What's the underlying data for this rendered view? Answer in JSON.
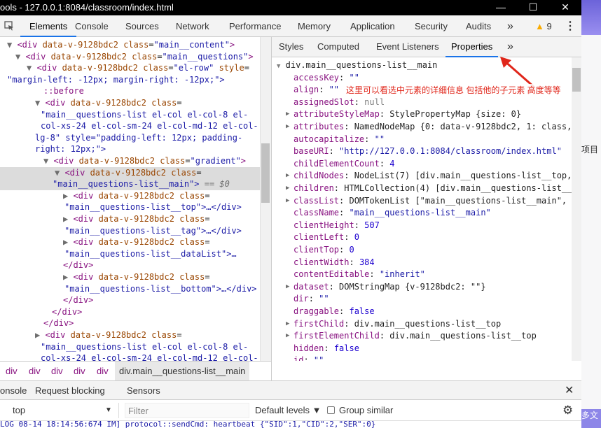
{
  "window": {
    "title": "ools - 127.0.0.1:8084/classroom/index.html",
    "minimize": "—",
    "maximize": "☐",
    "close": "✕"
  },
  "toolbar": {
    "inspect_icon": "inspect-icon",
    "tabs": [
      "Elements",
      "Console",
      "Sources",
      "Network",
      "Performance",
      "Memory",
      "Application",
      "Security",
      "Audits"
    ],
    "more": "»",
    "warnings": "9",
    "menu": "⋮"
  },
  "dom": [
    {
      "arrow": "▼",
      "tag": "<div ",
      "attrs": [
        [
          "data-v-9128bdc2",
          ""
        ],
        [
          "class",
          "\"main__content\""
        ]
      ],
      "end": ">"
    },
    {
      "arrow": "▼",
      "tag": "<div ",
      "attrs": [
        [
          "data-v-9128bdc2",
          ""
        ],
        [
          "class",
          "\"main__questions\""
        ]
      ],
      "end": ">"
    },
    {
      "arrow": "▼",
      "tag": "<div ",
      "attrs": [
        [
          "data-v-9128bdc2",
          ""
        ],
        [
          "class",
          "\"el-row\""
        ],
        [
          "style",
          ""
        ]
      ],
      "end": ""
    },
    {
      "cont": "\"margin-left: -12px; margin-right: -12px;\">"
    },
    {
      "pseudo": "::before"
    },
    {
      "arrow": "▼",
      "tag": "<div ",
      "attrs": [
        [
          "data-v-9128bdc2",
          ""
        ],
        [
          "class",
          ""
        ]
      ],
      "end": ""
    },
    {
      "cont": "\"main__questions-list el-col el-col-8 el-"
    },
    {
      "cont": "col-xs-24 el-col-sm-24 el-col-md-12 el-col-"
    },
    {
      "cont": "lg-8\" style=\"padding-left: 12px; padding-"
    },
    {
      "cont": "right: 12px;\">"
    },
    {
      "arrow": "▼",
      "tag": "<div ",
      "attrs": [
        [
          "data-v-9128bdc2",
          ""
        ],
        [
          "class",
          "\"gradient\""
        ]
      ],
      "end": ">"
    },
    {
      "arrow": "▼",
      "tag": "<div ",
      "attrs": [
        [
          "data-v-9128bdc2",
          ""
        ],
        [
          "class",
          ""
        ]
      ],
      "end": ""
    },
    {
      "cont": "\"main__questions-list__main\">",
      "extra": " == $0"
    },
    {
      "arrow": "▶",
      "tag": "<div ",
      "attrs": [
        [
          "data-v-9128bdc2",
          ""
        ],
        [
          "class",
          ""
        ]
      ],
      "end": ""
    },
    {
      "cont": "\"main__questions-list__top\">…</div>"
    },
    {
      "arrow": "▶",
      "tag": "<div ",
      "attrs": [
        [
          "data-v-9128bdc2",
          ""
        ],
        [
          "class",
          ""
        ]
      ],
      "end": ""
    },
    {
      "cont": "\"main__questions-list__tag\">…</div>"
    },
    {
      "arrow": "▶",
      "tag": "<div ",
      "attrs": [
        [
          "data-v-9128bdc2",
          ""
        ],
        [
          "class",
          ""
        ]
      ],
      "end": ""
    },
    {
      "cont": "\"main__questions-list__dataList\">…"
    },
    {
      "close": "</div>"
    },
    {
      "arrow": "▶",
      "tag": "<div ",
      "attrs": [
        [
          "data-v-9128bdc2",
          ""
        ],
        [
          "class",
          ""
        ]
      ],
      "end": ""
    },
    {
      "cont": "\"main__questions-list__bottom\">…</div>"
    },
    {
      "close": "</div>"
    },
    {
      "close": "</div>"
    },
    {
      "close": "</div>"
    },
    {
      "arrow": "▶",
      "tag": "<div ",
      "attrs": [
        [
          "data-v-9128bdc2",
          ""
        ],
        [
          "class",
          ""
        ]
      ],
      "end": ""
    },
    {
      "cont": "\"main__questions-list el-col el-col-8 el-"
    },
    {
      "cont": "col-xs-24 el-col-sm-24 el-col-md-12 el-col-"
    }
  ],
  "breadcrumbs": [
    "div",
    "div",
    "div",
    "div",
    "div",
    "div.main__questions-list__main"
  ],
  "side_tabs": [
    "Styles",
    "Computed",
    "Event Listeners",
    "Properties",
    "»"
  ],
  "properties": {
    "header": "div.main__questions-list__main",
    "rows": [
      {
        "key": "accessKey",
        "val": "\"\"",
        "kind": "str"
      },
      {
        "key": "align",
        "val": "\"\"",
        "kind": "str"
      },
      {
        "key": "assignedSlot",
        "val": "null",
        "kind": "gray"
      },
      {
        "key": "attributeStyleMap",
        "val": "StylePropertyMap {size: 0}",
        "kind": "obj",
        "arrow": true
      },
      {
        "key": "attributes",
        "val": "NamedNodeMap {0: data-v-9128bdc2, 1: class,",
        "kind": "obj",
        "arrow": true
      },
      {
        "key": "autocapitalize",
        "val": "\"\"",
        "kind": "str"
      },
      {
        "key": "baseURI",
        "val": "\"http://127.0.0.1:8084/classroom/index.html\"",
        "kind": "str"
      },
      {
        "key": "childElementCount",
        "val": "4",
        "kind": "num"
      },
      {
        "key": "childNodes",
        "val": "NodeList(7) [div.main__questions-list__top,",
        "kind": "obj",
        "arrow": true
      },
      {
        "key": "children",
        "val": "HTMLCollection(4) [div.main__questions-list__",
        "kind": "obj",
        "arrow": true
      },
      {
        "key": "classList",
        "val": "DOMTokenList [\"main__questions-list__main\",",
        "kind": "obj",
        "arrow": true
      },
      {
        "key": "className",
        "val": "\"main__questions-list__main\"",
        "kind": "str"
      },
      {
        "key": "clientHeight",
        "val": "507",
        "kind": "num"
      },
      {
        "key": "clientLeft",
        "val": "0",
        "kind": "num"
      },
      {
        "key": "clientTop",
        "val": "0",
        "kind": "num"
      },
      {
        "key": "clientWidth",
        "val": "384",
        "kind": "num"
      },
      {
        "key": "contentEditable",
        "val": "\"inherit\"",
        "kind": "str"
      },
      {
        "key": "dataset",
        "val": "DOMStringMap {v-9128bdc2: \"\"}",
        "kind": "obj",
        "arrow": true
      },
      {
        "key": "dir",
        "val": "\"\"",
        "kind": "str"
      },
      {
        "key": "draggable",
        "val": "false",
        "kind": "num"
      },
      {
        "key": "firstChild",
        "val": "div.main__questions-list__top",
        "kind": "obj",
        "arrow": true
      },
      {
        "key": "firstElementChild",
        "val": "div.main__questions-list__top",
        "kind": "obj",
        "arrow": true
      },
      {
        "key": "hidden",
        "val": "false",
        "kind": "num"
      },
      {
        "key": "id",
        "val": "\"\"",
        "kind": "str"
      }
    ]
  },
  "annotation": "这里可以看选中元素的详细信息 包括他的子元素 高度等等",
  "annotation_color": "#e0261a",
  "drawer": {
    "tabs": [
      "onsole",
      "Request blocking",
      "Sensors"
    ],
    "close": "✕"
  },
  "console": {
    "context": "top",
    "filter_placeholder": "Filter",
    "levels": "Default levels ▼",
    "group": "Group similar",
    "gear": "⚙"
  },
  "log": "LOG 08-14 18:14:56:674 IM] protocol::sendCmd: heartbeat {\"SID\":1,\"CID\":2,\"SER\":0}",
  "right_side": {
    "t1": "项目",
    "t2": "多文"
  }
}
